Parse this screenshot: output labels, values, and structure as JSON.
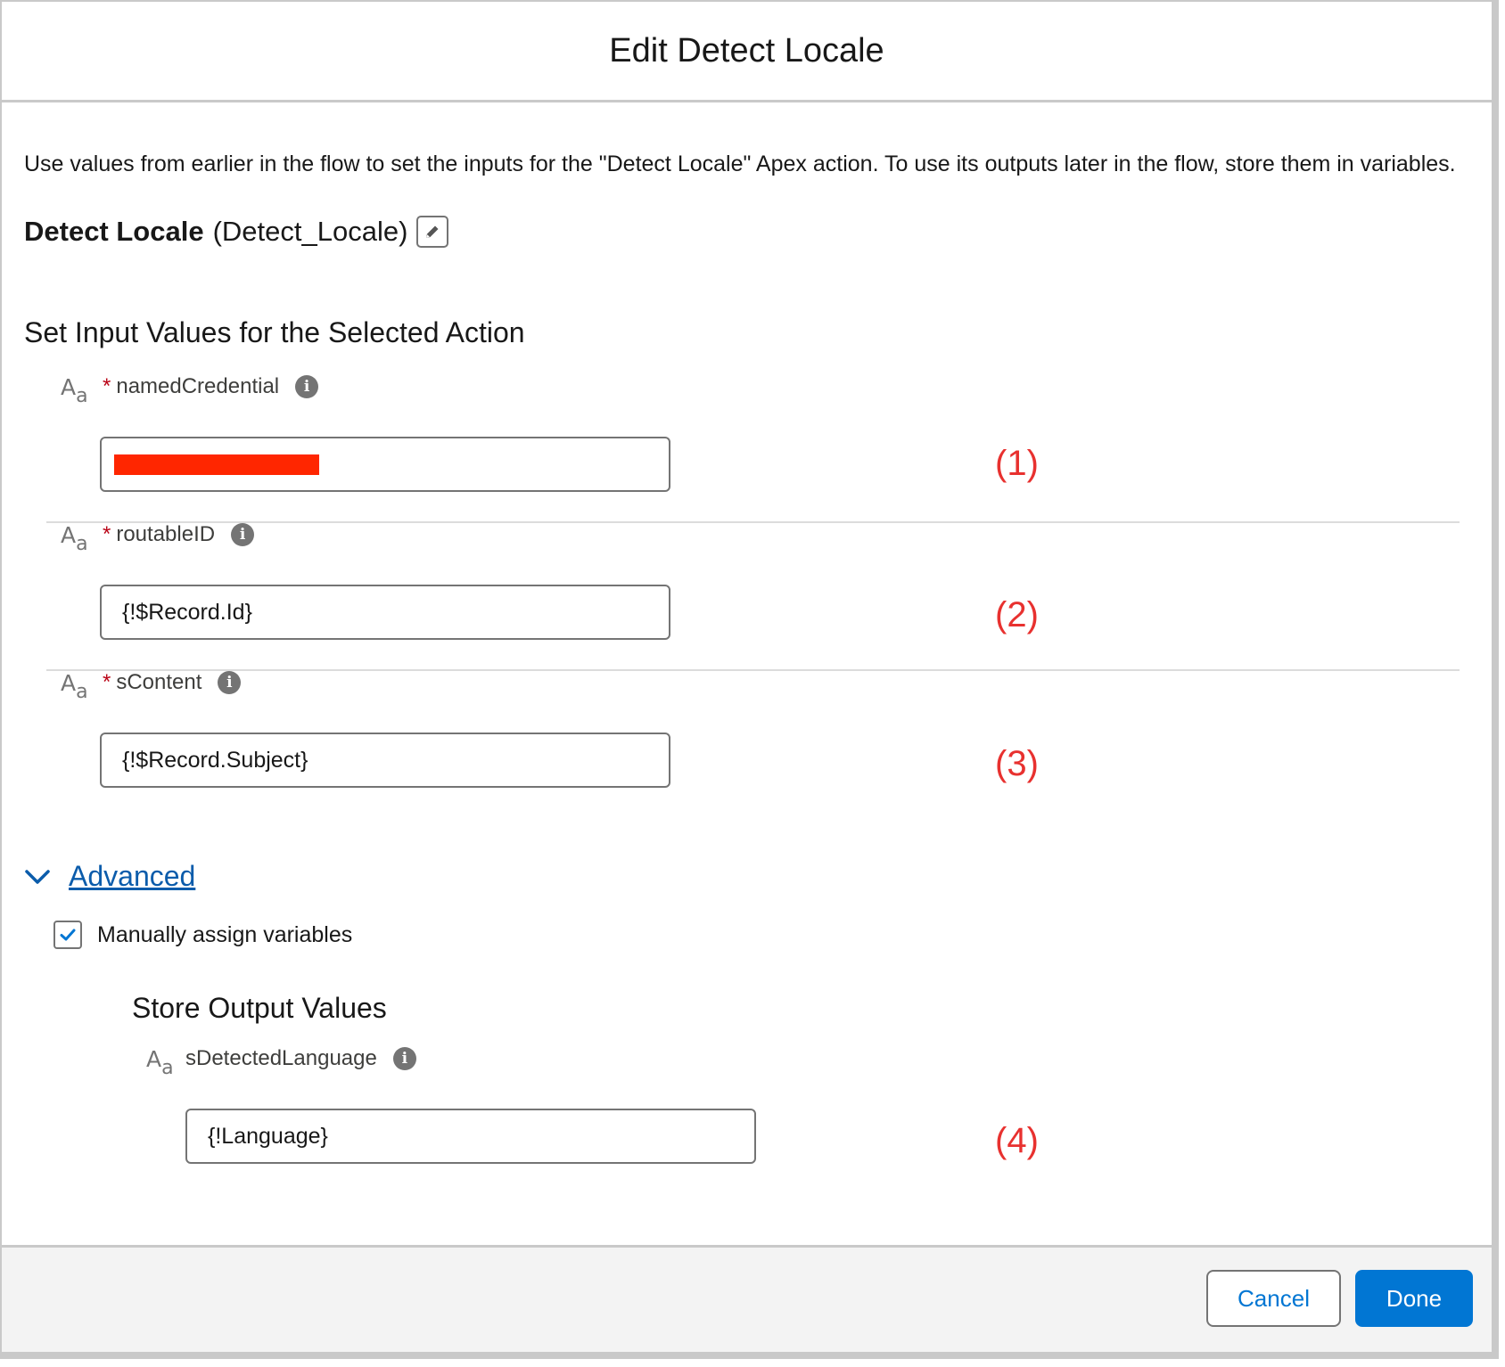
{
  "modal": {
    "title": "Edit Detect Locale",
    "intro": "Use values from earlier in the flow to set the inputs for the \"Detect Locale\" Apex action. To use its outputs later in the flow, store them in variables.",
    "action_label": "Detect Locale",
    "action_api_name": "(Detect_Locale)",
    "input_section_title": "Set Input Values for the Selected Action",
    "type_icon_text": {
      "big": "A",
      "small": "a"
    },
    "inputs": [
      {
        "label": "namedCredential",
        "required": "*",
        "value": "",
        "redacted": true,
        "marker": "(1)"
      },
      {
        "label": "routableID",
        "required": "*",
        "value": "{!$Record.Id}",
        "marker": "(2)"
      },
      {
        "label": "sContent",
        "required": "*",
        "value": "{!$Record.Subject}",
        "marker": "(3)"
      }
    ],
    "advanced_label": "Advanced",
    "manual_assign_label": "Manually assign variables",
    "manual_assign_checked": true,
    "output_section_title": "Store Output Values",
    "outputs": [
      {
        "label": "sDetectedLanguage",
        "value": "{!Language}",
        "marker": "(4)"
      }
    ],
    "info_icon_glyph": "i",
    "cancel_label": "Cancel",
    "done_label": "Done"
  },
  "colors": {
    "brand": "#0176d3",
    "link": "#0b5cab",
    "required": "#ba0517",
    "annotation": "#e8312f",
    "redaction": "#ff2600"
  },
  "icons": [
    "text-type-icon",
    "info-icon",
    "edit-pencil-icon",
    "chevron-down-icon",
    "checkmark-icon"
  ]
}
